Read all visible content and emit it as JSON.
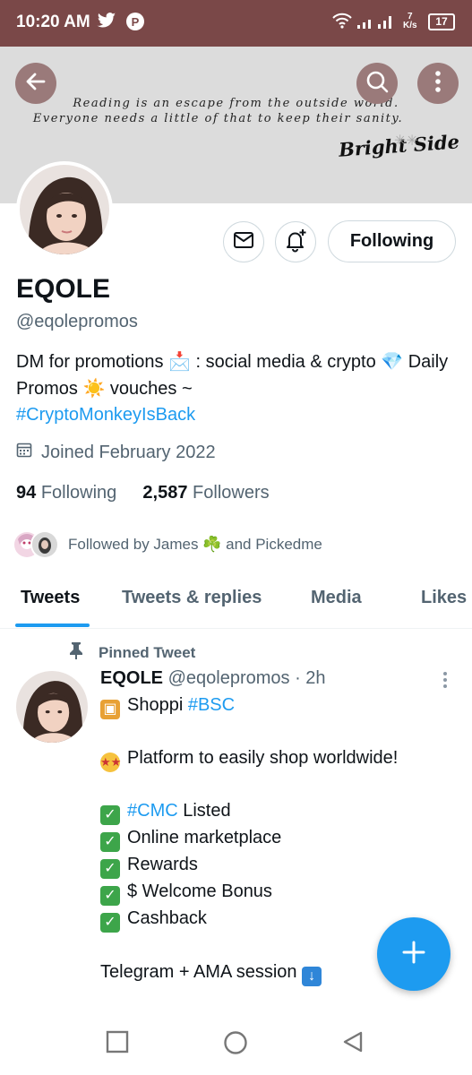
{
  "status_bar": {
    "time": "10:20 AM",
    "speed_value": "7",
    "speed_unit": "K/s",
    "battery": "17"
  },
  "banner": {
    "quote_line1": "Reading is an escape from the outside world.",
    "quote_line2": "Everyone needs a little of that to keep their sanity.",
    "brand": "Bright Side"
  },
  "profile": {
    "name": "EQOLE",
    "handle": "@eqolepromos",
    "bio_part1": "DM for promotions 📩 : social media & crypto 💎 Daily Promos ☀️ vouches ~",
    "bio_hashtag": "#CryptoMonkeyIsBack",
    "joined": "Joined February 2022",
    "following_count": "94",
    "following_label": "Following",
    "followers_count": "2,587",
    "followers_label": "Followers",
    "followed_by": "Followed by James ☘️ and Pickedme",
    "follow_button": "Following"
  },
  "tabs": [
    {
      "label": "Tweets"
    },
    {
      "label": "Tweets & replies"
    },
    {
      "label": "Media"
    },
    {
      "label": "Likes"
    }
  ],
  "tweet": {
    "pinned_label": "Pinned Tweet",
    "author_name": "EQOLE",
    "author_meta": "@eqolepromos · 2h",
    "line1_text": "Shoppi",
    "line1_tag": "#BSC",
    "line2_text": "Platform to easily shop worldwide!",
    "list_1_tag": "#CMC",
    "list_1_text": "Listed",
    "list_2": "Online marketplace",
    "list_3": "Rewards",
    "list_4": "$ Welcome Bonus",
    "list_5": "Cashback",
    "last_line": "Telegram + AMA session"
  },
  "colors": {
    "accent": "#1d9bf0",
    "status_bar": "#7a4848",
    "muted_text": "#536471"
  },
  "icons": [
    "back-arrow-icon",
    "search-icon",
    "more-vertical-icon",
    "mail-icon",
    "bell-plus-icon",
    "calendar-icon",
    "pin-icon",
    "compose-plus-icon",
    "twitter-bird-icon",
    "wifi-icon",
    "signal-icon"
  ]
}
